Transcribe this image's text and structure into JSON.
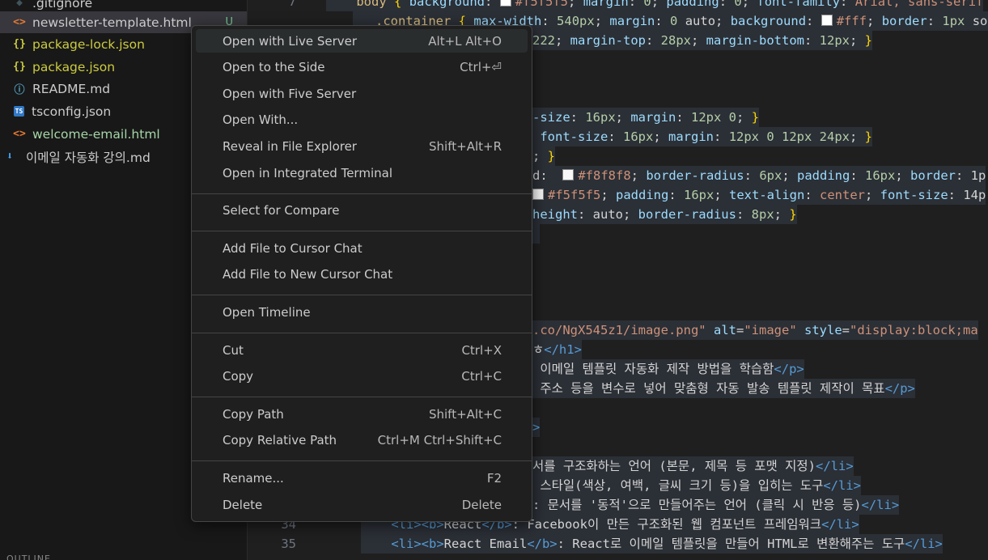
{
  "explorer": {
    "files": [
      {
        "name": ".gitignore",
        "icon": "gitignore-icon",
        "glyph": "◆",
        "kind": "git"
      },
      {
        "name": "newsletter-template.html",
        "icon": "html-file-icon",
        "glyph": "<>",
        "kind": "html",
        "badge": "U"
      },
      {
        "name": "package-lock.json",
        "icon": "json-file-icon",
        "glyph": "{}",
        "kind": "json"
      },
      {
        "name": "package.json",
        "icon": "json-file-icon",
        "glyph": "{}",
        "kind": "json"
      },
      {
        "name": "README.md",
        "icon": "info-icon",
        "glyph": "ⓘ",
        "kind": "info"
      },
      {
        "name": "tsconfig.json",
        "icon": "typescript-icon",
        "glyph": "TS",
        "kind": "ts"
      },
      {
        "name": "welcome-email.html",
        "icon": "html-file-icon",
        "glyph": "<>",
        "kind": "html"
      },
      {
        "name": "이메일 자동화 강의.md",
        "icon": "markdown-download-icon",
        "glyph": "⬇",
        "kind": "md"
      }
    ],
    "outline_label": "OUTLINE"
  },
  "editor": {
    "line_numbers": [
      "7",
      "34",
      "35"
    ],
    "lines": [
      [
        {
          "c": "tx",
          "t": "    "
        },
        {
          "c": "kw",
          "t": "body"
        },
        {
          "c": "tx",
          "t": " "
        },
        {
          "c": "br",
          "t": "{"
        },
        {
          "c": "tx",
          "t": " "
        },
        {
          "c": "pr",
          "t": "background"
        },
        {
          "c": "tx",
          "t": ": "
        },
        {
          "c": "sw",
          "t": ""
        },
        {
          "c": "st",
          "t": "#f5f5f5"
        },
        {
          "c": "tx",
          "t": "; "
        },
        {
          "c": "pr",
          "t": "margin"
        },
        {
          "c": "tx",
          "t": ": "
        },
        {
          "c": "nu",
          "t": "0"
        },
        {
          "c": "tx",
          "t": "; "
        },
        {
          "c": "pr",
          "t": "padding"
        },
        {
          "c": "tx",
          "t": ": "
        },
        {
          "c": "nu",
          "t": "0"
        },
        {
          "c": "tx",
          "t": "; "
        },
        {
          "c": "pr",
          "t": "font-family"
        },
        {
          "c": "tx",
          "t": ": "
        },
        {
          "c": "st",
          "t": "Arial, sans-serif"
        }
      ],
      [
        {
          "c": "tx",
          "t": "   "
        },
        {
          "c": "kw",
          "t": ".container"
        },
        {
          "c": "tx",
          "t": " "
        },
        {
          "c": "br",
          "t": "{"
        },
        {
          "c": "tx",
          "t": " "
        },
        {
          "c": "pr",
          "t": "max-width"
        },
        {
          "c": "tx",
          "t": ": "
        },
        {
          "c": "nu",
          "t": "540px"
        },
        {
          "c": "tx",
          "t": "; "
        },
        {
          "c": "pr",
          "t": "margin"
        },
        {
          "c": "tx",
          "t": ": "
        },
        {
          "c": "nu",
          "t": "0"
        },
        {
          "c": "tx",
          "t": " auto; "
        },
        {
          "c": "pr",
          "t": "background"
        },
        {
          "c": "tx",
          "t": ": "
        },
        {
          "c": "sw",
          "t": ""
        },
        {
          "c": "st",
          "t": "#fff"
        },
        {
          "c": "tx",
          "t": "; "
        },
        {
          "c": "pr",
          "t": "border"
        },
        {
          "c": "tx",
          "t": ": "
        },
        {
          "c": "nu",
          "t": "1px"
        },
        {
          "c": "tx",
          "t": " sol"
        }
      ],
      [
        {
          "c": "nu",
          "t": "222"
        },
        {
          "c": "tx",
          "t": "; "
        },
        {
          "c": "pr",
          "t": "margin-top"
        },
        {
          "c": "tx",
          "t": ": "
        },
        {
          "c": "nu",
          "t": "28px"
        },
        {
          "c": "tx",
          "t": "; "
        },
        {
          "c": "pr",
          "t": "margin-bottom"
        },
        {
          "c": "tx",
          "t": ": "
        },
        {
          "c": "nu",
          "t": "12px"
        },
        {
          "c": "tx",
          "t": "; "
        },
        {
          "c": "br",
          "t": "}"
        }
      ],
      [
        {
          "c": "pr",
          "t": "-size"
        },
        {
          "c": "tx",
          "t": ": "
        },
        {
          "c": "nu",
          "t": "16px"
        },
        {
          "c": "tx",
          "t": "; "
        },
        {
          "c": "pr",
          "t": "margin"
        },
        {
          "c": "tx",
          "t": ": "
        },
        {
          "c": "nu",
          "t": "12px 0"
        },
        {
          "c": "tx",
          "t": "; "
        },
        {
          "c": "br",
          "t": "}"
        }
      ],
      [
        {
          "c": "tx",
          "t": " "
        },
        {
          "c": "pr",
          "t": "font-size"
        },
        {
          "c": "tx",
          "t": ": "
        },
        {
          "c": "nu",
          "t": "16px"
        },
        {
          "c": "tx",
          "t": "; "
        },
        {
          "c": "pr",
          "t": "margin"
        },
        {
          "c": "tx",
          "t": ": "
        },
        {
          "c": "nu",
          "t": "12px 0 12px 24px"
        },
        {
          "c": "tx",
          "t": "; "
        },
        {
          "c": "br",
          "t": "}"
        }
      ],
      [
        {
          "c": "tx",
          "t": "; "
        },
        {
          "c": "br",
          "t": "}"
        }
      ],
      [
        {
          "c": "tx",
          "t": "d:  "
        },
        {
          "c": "sw f8",
          "t": ""
        },
        {
          "c": "st",
          "t": "#f8f8f8"
        },
        {
          "c": "tx",
          "t": "; "
        },
        {
          "c": "pr",
          "t": "border-radius"
        },
        {
          "c": "tx",
          "t": ": "
        },
        {
          "c": "nu",
          "t": "6px"
        },
        {
          "c": "tx",
          "t": "; "
        },
        {
          "c": "pr",
          "t": "padding"
        },
        {
          "c": "tx",
          "t": ": "
        },
        {
          "c": "nu",
          "t": "16px"
        },
        {
          "c": "tx",
          "t": "; "
        },
        {
          "c": "pr",
          "t": "border"
        },
        {
          "c": "tx",
          "t": ": 1p"
        }
      ],
      [
        {
          "c": "sw f5",
          "t": ""
        },
        {
          "c": "st",
          "t": "#f5f5f5"
        },
        {
          "c": "tx",
          "t": "; "
        },
        {
          "c": "pr",
          "t": "padding"
        },
        {
          "c": "tx",
          "t": ": "
        },
        {
          "c": "nu",
          "t": "16px"
        },
        {
          "c": "tx",
          "t": "; "
        },
        {
          "c": "pr",
          "t": "text-align"
        },
        {
          "c": "tx",
          "t": ": "
        },
        {
          "c": "st",
          "t": "center"
        },
        {
          "c": "tx",
          "t": "; "
        },
        {
          "c": "pr",
          "t": "font-size"
        },
        {
          "c": "tx",
          "t": ": 14p"
        }
      ],
      [
        {
          "c": "pr",
          "t": "height"
        },
        {
          "c": "tx",
          "t": ": auto; "
        },
        {
          "c": "pr",
          "t": "border-radius"
        },
        {
          "c": "tx",
          "t": ": "
        },
        {
          "c": "nu",
          "t": "8px"
        },
        {
          "c": "tx",
          "t": "; "
        },
        {
          "c": "br",
          "t": "}"
        }
      ],
      [
        {
          "c": "tx",
          "t": " "
        }
      ],
      [
        {
          "c": "st",
          "t": ".co/NgX545z1/image.png\""
        },
        {
          "c": "tx",
          "t": " "
        },
        {
          "c": "at",
          "t": "alt"
        },
        {
          "c": "tx",
          "t": "="
        },
        {
          "c": "st",
          "t": "\"image\""
        },
        {
          "c": "tx",
          "t": " "
        },
        {
          "c": "at",
          "t": "style"
        },
        {
          "c": "tx",
          "t": "="
        },
        {
          "c": "st",
          "t": "\"display:block;ma"
        }
      ],
      [
        {
          "c": "tx",
          "t": "ㅎ"
        },
        {
          "c": "tg",
          "t": "</h1>"
        }
      ],
      [
        {
          "c": "tx",
          "t": " 이메일 템플릿 자동화 제작 방법을 학습함"
        },
        {
          "c": "tg",
          "t": "</p>"
        }
      ],
      [
        {
          "c": "tx",
          "t": " 주소 등을 변수로 넣어 맞춤형 자동 발송 템플릿 제작이 목표"
        },
        {
          "c": "tg",
          "t": "</p>"
        }
      ],
      [
        {
          "c": "tg",
          "t": ">"
        }
      ],
      [
        {
          "c": "tx",
          "t": "서를 구조화하는 언어 (본문, 제목 등 포맷 지정)"
        },
        {
          "c": "tg",
          "t": "</li>"
        }
      ],
      [
        {
          "c": "tx",
          "t": " 스타일(색상, 여백, 글씨 크기 등)을 입히는 도구"
        },
        {
          "c": "tg",
          "t": "</li>"
        }
      ],
      [
        {
          "c": "tx",
          "t": ": 문서를 '동적'으로 만들어주는 언어 (클릭 시 반응 등)"
        },
        {
          "c": "tg",
          "t": "</li>"
        }
      ],
      [
        {
          "c": "tx",
          "t": "    "
        },
        {
          "c": "tg",
          "t": "<li><b>"
        },
        {
          "c": "tx",
          "t": "React"
        },
        {
          "c": "tg",
          "t": "</b>"
        },
        {
          "c": "tx",
          "t": ": Facebook이 만든 구조화된 웹 컴포넌트 프레임워크"
        },
        {
          "c": "tg",
          "t": "</li>"
        }
      ],
      [
        {
          "c": "tx",
          "t": "    "
        },
        {
          "c": "tg",
          "t": "<li><b>"
        },
        {
          "c": "tx",
          "t": "React Email"
        },
        {
          "c": "tg",
          "t": "</b>"
        },
        {
          "c": "tx",
          "t": ": React로 이메일 템플릿을 만들어 HTML로 변환해주는 도구"
        },
        {
          "c": "tg",
          "t": "</li>"
        }
      ]
    ]
  },
  "context_menu": {
    "items": [
      {
        "label": "Open with Live Server",
        "shortcut": "Alt+L Alt+O",
        "name": "menu-open-with-live-server",
        "highlighted": true
      },
      {
        "label": "Open to the Side",
        "shortcut": "Ctrl+⏎",
        "name": "menu-open-to-the-side"
      },
      {
        "label": "Open with Five Server",
        "shortcut": "",
        "name": "menu-open-with-five-server"
      },
      {
        "label": "Open With...",
        "shortcut": "",
        "name": "menu-open-with"
      },
      {
        "label": "Reveal in File Explorer",
        "shortcut": "Shift+Alt+R",
        "name": "menu-reveal-in-file-explorer"
      },
      {
        "label": "Open in Integrated Terminal",
        "shortcut": "",
        "name": "menu-open-in-integrated-terminal"
      },
      {
        "sep": true
      },
      {
        "label": "Select for Compare",
        "shortcut": "",
        "name": "menu-select-for-compare"
      },
      {
        "sep": true
      },
      {
        "label": "Add File to Cursor Chat",
        "shortcut": "",
        "name": "menu-add-file-to-cursor-chat"
      },
      {
        "label": "Add File to New Cursor Chat",
        "shortcut": "",
        "name": "menu-add-file-to-new-cursor-chat"
      },
      {
        "sep": true
      },
      {
        "label": "Open Timeline",
        "shortcut": "",
        "name": "menu-open-timeline"
      },
      {
        "sep": true
      },
      {
        "label": "Cut",
        "shortcut": "Ctrl+X",
        "name": "menu-cut"
      },
      {
        "label": "Copy",
        "shortcut": "Ctrl+C",
        "name": "menu-copy"
      },
      {
        "sep": true
      },
      {
        "label": "Copy Path",
        "shortcut": "Shift+Alt+C",
        "name": "menu-copy-path"
      },
      {
        "label": "Copy Relative Path",
        "shortcut": "Ctrl+M Ctrl+Shift+C",
        "name": "menu-copy-relative-path"
      },
      {
        "sep": true
      },
      {
        "label": "Rename...",
        "shortcut": "F2",
        "name": "menu-rename"
      },
      {
        "label": "Delete",
        "shortcut": "Delete",
        "name": "menu-delete"
      }
    ]
  }
}
